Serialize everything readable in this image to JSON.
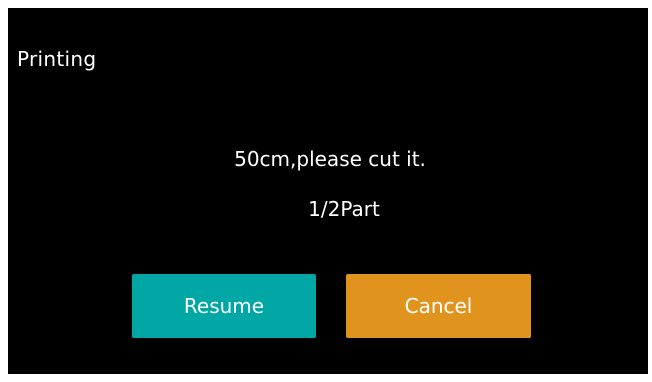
{
  "dialog": {
    "title": "Printing",
    "message": "50cm,please cut it.",
    "part": "1/2Part"
  },
  "buttons": {
    "resume_label": "Resume",
    "cancel_label": "Cancel"
  },
  "colors": {
    "background": "#000000",
    "resume": "#00a7a5",
    "cancel": "#e0941e",
    "text": "#ffffff"
  }
}
